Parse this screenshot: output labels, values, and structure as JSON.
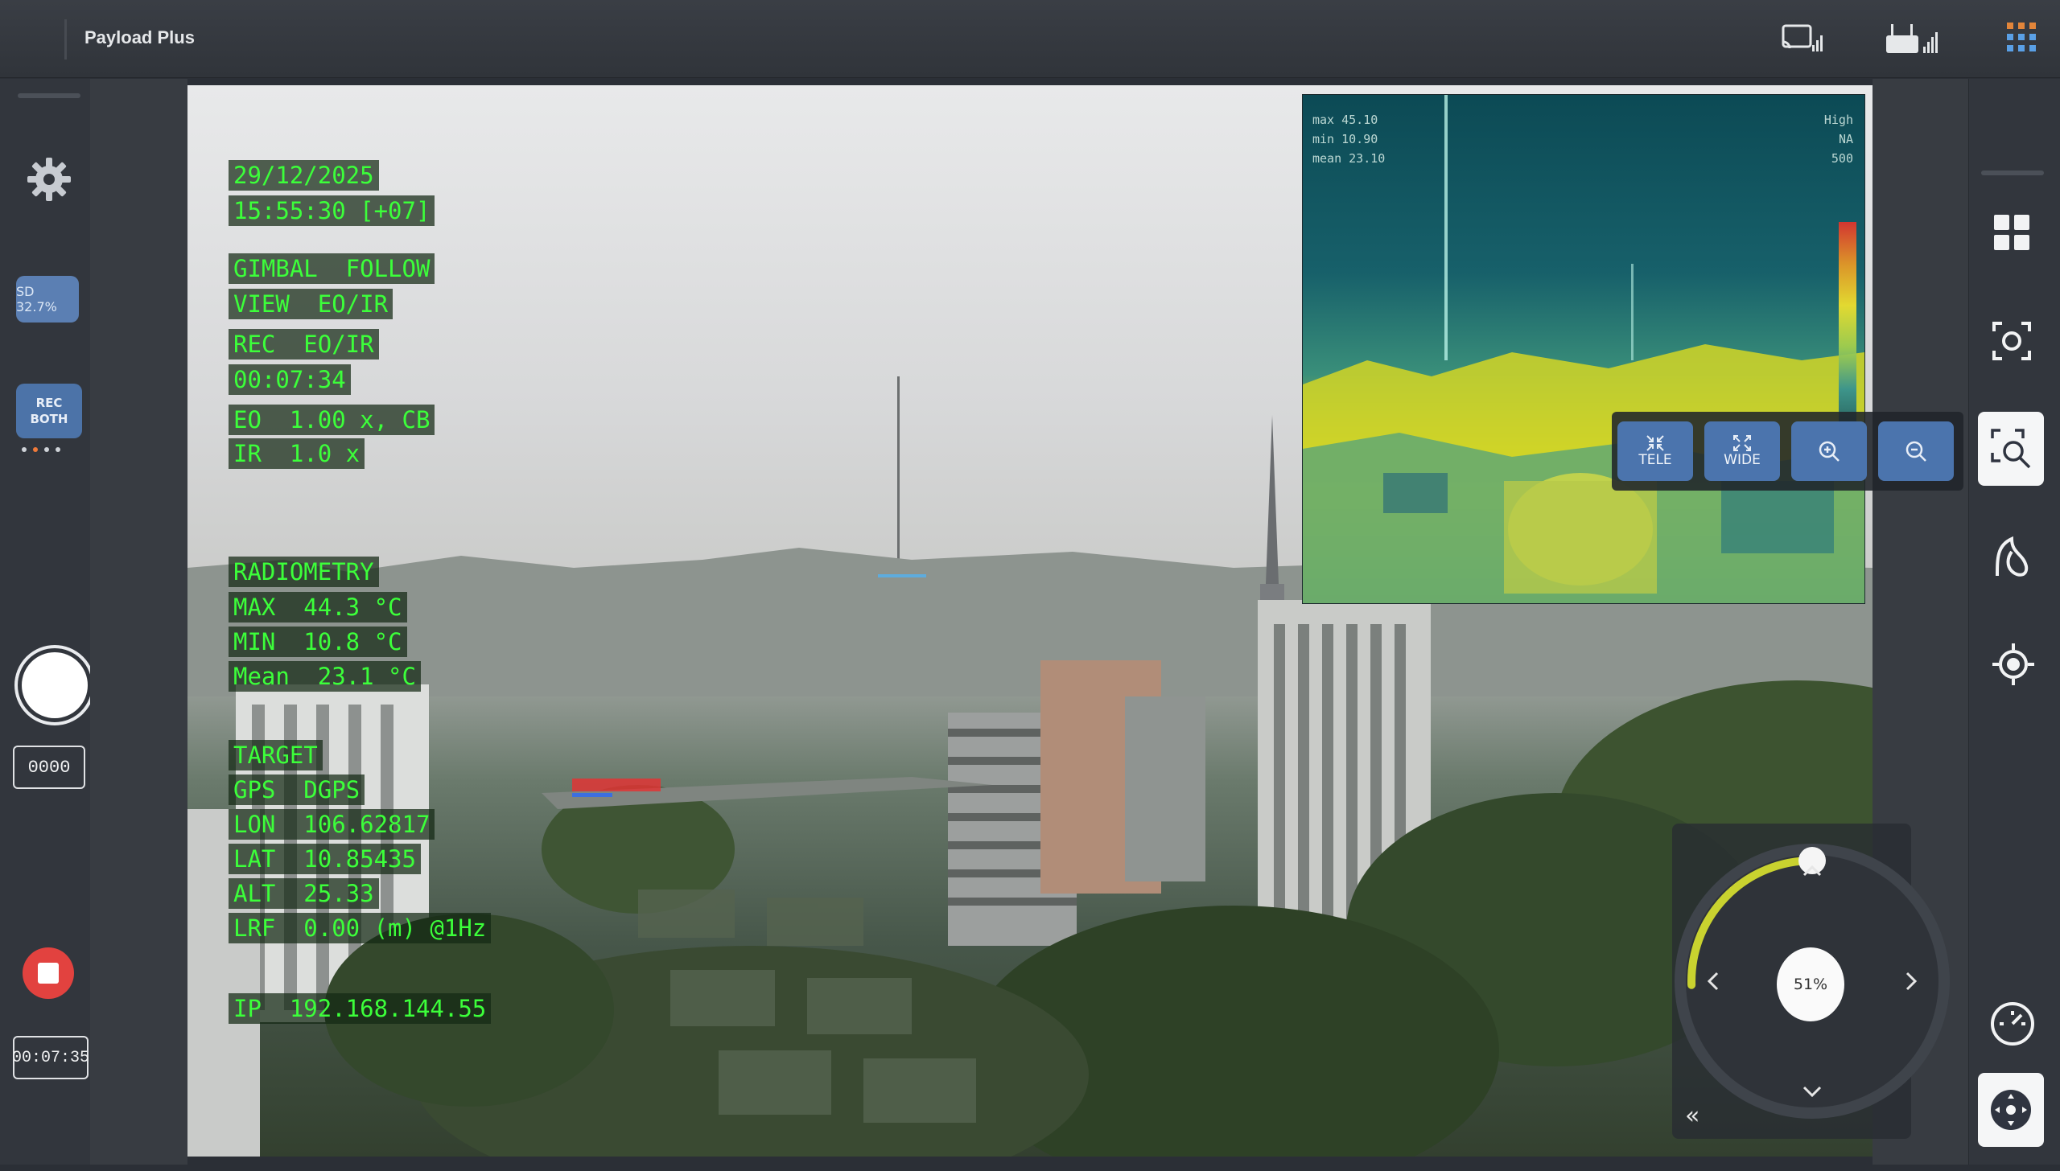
{
  "app": {
    "title": "Payload Plus"
  },
  "left_toolbar": {
    "sd_label": "SD 32.7%",
    "rec_mode": {
      "line1": "REC",
      "line2": "BOTH"
    },
    "photo_counter": "0000",
    "record_timer": "00:07:35"
  },
  "osd": {
    "date": "29/12/2025",
    "time": "15:55:30 [+07]",
    "gimbal": "GIMBAL  FOLLOW",
    "view": "VIEW  EO/IR",
    "rec": "REC  EO/IR",
    "rec_time": "00:07:34",
    "eo_zoom": "EO  1.00 x, CB",
    "ir_zoom": "IR  1.0 x",
    "radiometry_title": "RADIOMETRY",
    "max": "MAX  44.3 °C",
    "min": "MIN  10.8 °C",
    "mean": "Mean  23.1 °C",
    "target_title": "TARGET",
    "gps": "GPS  DGPS",
    "lon": "LON  106.62817",
    "lat": "LAT  10.85435",
    "alt": "ALT  25.33",
    "lrf": "LRF  0.00 (m) @1Hz",
    "ip": "IP  192.168.144.55"
  },
  "ir_inset": {
    "line1": "max  45.10",
    "line2": "min  10.90",
    "line3": "mean  23.10",
    "r1": "High",
    "r2": "NA",
    "r3": "500"
  },
  "zoom_controls": {
    "tele_label": "TELE",
    "wide_label": "WIDE"
  },
  "joystick": {
    "speed_label": "51%",
    "speed_value": 0.51,
    "collapse_label": "«"
  },
  "icons": {
    "settings": "gear-icon",
    "cast": "cast-signal-icon",
    "rc": "remote-controller-signal-icon",
    "apps": "apps-grid-icon",
    "layout": "layout-grid-icon",
    "screenshot": "camera-capture-icon",
    "zoom_search": "zoom-search-icon",
    "leaf": "leaf-icon",
    "target": "target-crosshair-icon",
    "gauge": "gauge-icon",
    "gimbal_center": "gimbal-center-icon"
  },
  "colors": {
    "osd_text": "#3cff3a",
    "accent_blue": "#4b74ad",
    "record_red": "#e2423f",
    "joystick_arc": "#c9d22f"
  }
}
